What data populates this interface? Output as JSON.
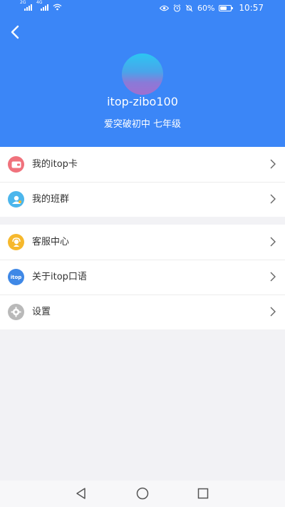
{
  "status_bar": {
    "sim1_tag": "2G",
    "sim2_tag": "4G",
    "battery": "60%",
    "time": "10:57",
    "battery_level": 0.6
  },
  "header": {
    "username": "itop-zibo100",
    "school": "爱突破初中 七年级",
    "bg_color": "#3b86f7"
  },
  "menu_group_1": [
    {
      "label": "我的itop卡",
      "icon": "card-icon",
      "color": "#f0727c"
    },
    {
      "label": "我的班群",
      "icon": "class-group-icon",
      "color": "#4cb6ec"
    }
  ],
  "menu_group_2": [
    {
      "label": "客服中心",
      "icon": "customer-service-icon",
      "color": "#f6b82c"
    },
    {
      "label": "关于itop口语",
      "icon": "itop-logo-icon",
      "color": "#3f88e6",
      "icon_text": "itop"
    },
    {
      "label": "设置",
      "icon": "gear-icon",
      "color": "#b9b9b9"
    }
  ],
  "nav": {
    "back": "back-triangle-icon",
    "home": "home-circle-icon",
    "recent": "recent-square-icon"
  }
}
